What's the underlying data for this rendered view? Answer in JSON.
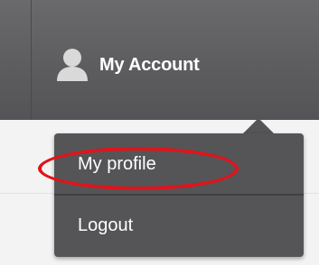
{
  "header": {
    "account_label": "My Account",
    "account_icon": "user-icon"
  },
  "dropdown": {
    "items": [
      {
        "label": "My profile",
        "highlighted": true
      },
      {
        "label": "Logout",
        "highlighted": false
      }
    ]
  },
  "colors": {
    "topbar": "#5d5d60",
    "dropdown_bg": "#555557",
    "text": "#ffffff",
    "highlight": "#e0141b"
  }
}
